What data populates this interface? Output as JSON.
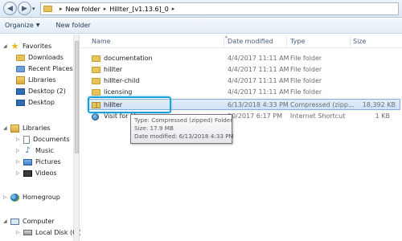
{
  "address": {
    "crumbs": [
      "New folder",
      "Hillter_[v1.13.6]_0"
    ]
  },
  "toolbar": {
    "organize_label": "Organize",
    "new_folder_label": "New folder"
  },
  "nav": {
    "favorites": "Favorites",
    "downloads": "Downloads",
    "recent_places": "Recent Places",
    "libraries_fav": "Libraries",
    "desktop2": "Desktop (2)",
    "desktop": "Desktop",
    "libraries": "Libraries",
    "documents": "Documents",
    "music": "Music",
    "pictures": "Pictures",
    "videos": "Videos",
    "homegroup": "Homegroup",
    "computer": "Computer",
    "local_disk": "Local Disk (C:)"
  },
  "columns": {
    "name": "Name",
    "date": "Date modified",
    "type": "Type",
    "size": "Size"
  },
  "files": [
    {
      "name": "documentation",
      "date": "4/4/2017 11:11 AM",
      "type": "File folder",
      "size": "",
      "icon": "folder-icon"
    },
    {
      "name": "hillter",
      "date": "4/4/2017 11:11 AM",
      "type": "File folder",
      "size": "",
      "icon": "folder-icon"
    },
    {
      "name": "hillter-child",
      "date": "4/4/2017 11:11 AM",
      "type": "File folder",
      "size": "",
      "icon": "folder-icon"
    },
    {
      "name": "licensing",
      "date": "4/4/2017 11:11 AM",
      "type": "File folder",
      "size": "",
      "icon": "folder-icon"
    },
    {
      "name": "hillter",
      "date": "6/13/2018 4:33 PM",
      "type": "Compressed (zipp...",
      "size": "18,392 KB",
      "icon": "zip-folder-icon"
    },
    {
      "name": "Visit for M",
      "date": "30/2017 6:17 PM",
      "type": "Internet Shortcut",
      "size": "1 KB",
      "icon": "internet-shortcut-icon"
    }
  ],
  "tooltip": {
    "type_line": "Type: Compressed (zipped) Folder",
    "size_line": "Size: 17.9 MB",
    "date_line": "Date modified: 6/13/2018 4:33 PM"
  }
}
